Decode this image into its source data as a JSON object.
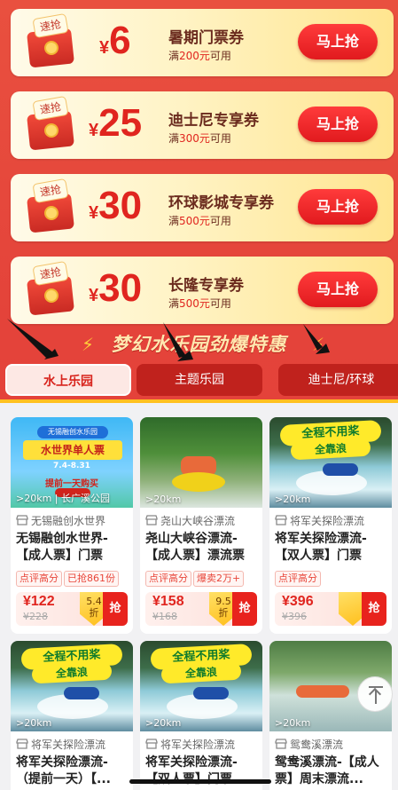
{
  "coupons": [
    {
      "tag": "速抢",
      "currency": "¥",
      "amount": "6",
      "title": "暑期门票券",
      "min_prefix": "满",
      "min_amount": "200元",
      "min_suffix": "可用",
      "button": "马上抢"
    },
    {
      "tag": "速抢",
      "currency": "¥",
      "amount": "25",
      "title": "迪士尼专享券",
      "min_prefix": "满",
      "min_amount": "300元",
      "min_suffix": "可用",
      "button": "马上抢"
    },
    {
      "tag": "速抢",
      "currency": "¥",
      "amount": "30",
      "title": "环球影城专享券",
      "min_prefix": "满",
      "min_amount": "500元",
      "min_suffix": "可用",
      "button": "马上抢"
    },
    {
      "tag": "速抢",
      "currency": "¥",
      "amount": "30",
      "title": "长隆专享券",
      "min_prefix": "满",
      "min_amount": "500元",
      "min_suffix": "可用",
      "button": "马上抢"
    }
  ],
  "banner": {
    "title": "梦幻水乐园劲爆特惠"
  },
  "tabs": [
    {
      "label": "水上乐园",
      "active": true
    },
    {
      "label": "主题乐园",
      "active": false
    },
    {
      "label": "迪士尼/环球",
      "active": false
    }
  ],
  "products": [
    {
      "poster": {
        "badge": "无锡融创水乐园",
        "title": "水世界单人票",
        "date": "7.4-8.31",
        "sub": "提前一天购买"
      },
      "distance": ">20km | 长广溪公园",
      "merchant": "无锡融创水世界",
      "name": "无锡融创水世界-【成人票】门票",
      "tags": [
        "点评高分",
        "已抢861份"
      ],
      "price": "¥122",
      "old_price": "¥228",
      "discount": "5.4",
      "discount_unit": "折",
      "grab": "抢"
    },
    {
      "distance": ">20km",
      "merchant": "尧山大峡谷漂流",
      "name": "尧山大峡谷漂流-【成人票】漂流票",
      "tags": [
        "点评高分",
        "爆卖2万+"
      ],
      "price": "¥158",
      "old_price": "¥168",
      "discount": "9.5",
      "discount_unit": "折",
      "grab": "抢"
    },
    {
      "poster": {
        "line1": "全程不用桨",
        "line2": "全靠浪"
      },
      "distance": ">20km",
      "merchant": "将军关探险漂流",
      "name": "将军关探险漂流-【双人票】门票",
      "tags": [
        "点评高分"
      ],
      "price": "¥396",
      "old_price": "¥396",
      "grab": "抢"
    },
    {
      "poster": {
        "line1": "全程不用桨",
        "line2": "全靠浪"
      },
      "distance": ">20km",
      "merchant": "将军关探险漂流",
      "name": "将军关探险漂流-（提前一天）【..."
    },
    {
      "poster": {
        "line1": "全程不用桨",
        "line2": "全靠浪"
      },
      "distance": ">20km",
      "merchant": "将军关探险漂流",
      "name": "将军关探险漂流-【双人票】门票"
    },
    {
      "distance": ">20km",
      "merchant": "鸳鸯溪漂流",
      "name": "鸳鸯溪漂流-【成人票】周末漂流..."
    }
  ],
  "icons": {
    "back_to_top": "arrow-up-to-line-icon",
    "shop": "shop-icon"
  }
}
